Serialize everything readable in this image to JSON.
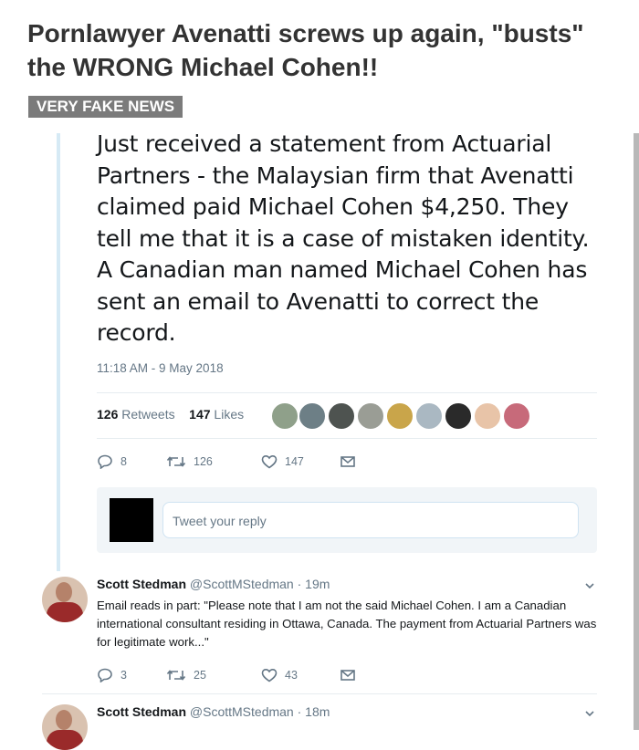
{
  "headline": "Pornlawyer Avenatti screws up again, \"busts\" the WRONG Michael Cohen!!",
  "tag": "VERY FAKE NEWS",
  "tweet": {
    "text": "Just received a statement from Actuarial Partners - the Malaysian firm that Avenatti claimed paid Michael Cohen $4,250. They tell me that it is a case of mistaken identity. A Canadian man named Michael Cohen has sent an email to Avenatti to correct the record.",
    "time": "11:18 AM - 9 May 2018",
    "retweets_count": "126",
    "retweets_label": "Retweets",
    "likes_count": "147",
    "likes_label": "Likes",
    "actions": {
      "replies": "8",
      "retweets": "126",
      "likes": "147"
    },
    "reply_placeholder": "Tweet your reply"
  },
  "replies": [
    {
      "name": "Scott Stedman",
      "handle": "@ScottMStedman",
      "time": "· 19m",
      "text": "Email reads in part: \"Please note that I am not the said Michael Cohen. I am a Canadian international consultant residing in Ottawa, Canada. The payment from Actuarial Partners was for legitimate work...\"",
      "actions": {
        "replies": "3",
        "retweets": "25",
        "likes": "43"
      }
    },
    {
      "name": "Scott Stedman",
      "handle": "@ScottMStedman",
      "time": "· 18m"
    }
  ],
  "colors": {
    "text": "#14171a",
    "muted": "#657786",
    "accent": "#1da1f2",
    "tag_bg": "#7b7b7b"
  },
  "icons": [
    "reply-icon",
    "retweet-icon",
    "like-icon",
    "message-icon",
    "chevron-down-icon"
  ]
}
